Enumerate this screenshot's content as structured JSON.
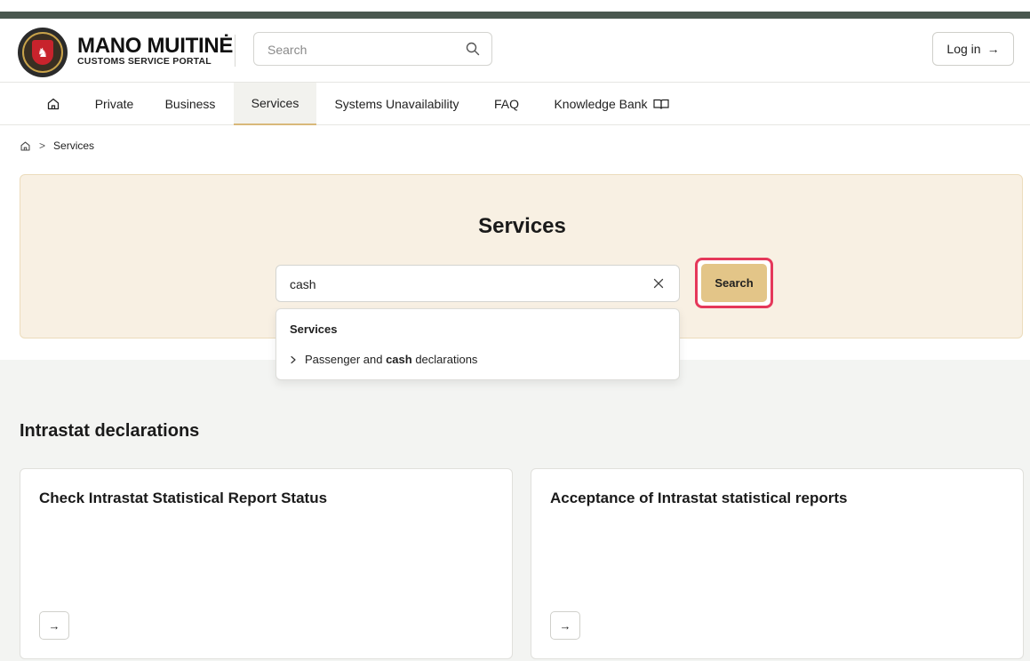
{
  "brand": {
    "title": "MANO MUITINĖ",
    "subtitle": "CUSTOMS SERVICE PORTAL"
  },
  "header": {
    "search_placeholder": "Search",
    "login_label": "Log in",
    "login_arrow": "→"
  },
  "nav": {
    "items": [
      {
        "label": "Private"
      },
      {
        "label": "Business"
      },
      {
        "label": "Services",
        "active": true
      },
      {
        "label": "Systems Unavailability"
      },
      {
        "label": "FAQ"
      },
      {
        "label": "Knowledge Bank"
      }
    ]
  },
  "breadcrumb": {
    "separator": ">",
    "current": "Services"
  },
  "hero": {
    "title": "Services",
    "search_value": "cash",
    "search_button": "Search"
  },
  "dropdown": {
    "group_label": "Services",
    "option_prefix": "Passenger and ",
    "option_match": "cash",
    "option_suffix": " declarations"
  },
  "section": {
    "title": "Intrastat declarations",
    "cards": [
      {
        "title": "Check Intrastat Statistical Report Status",
        "arrow": "→"
      },
      {
        "title": "Acceptance of Intrastat statistical reports",
        "arrow": "→"
      }
    ]
  },
  "colors": {
    "top_bar": "#4a584f",
    "hero_bg": "#f8f0e3",
    "button_gold": "#e3c588",
    "highlight": "#e5385a",
    "nav_active_underline": "#d9b97a"
  }
}
